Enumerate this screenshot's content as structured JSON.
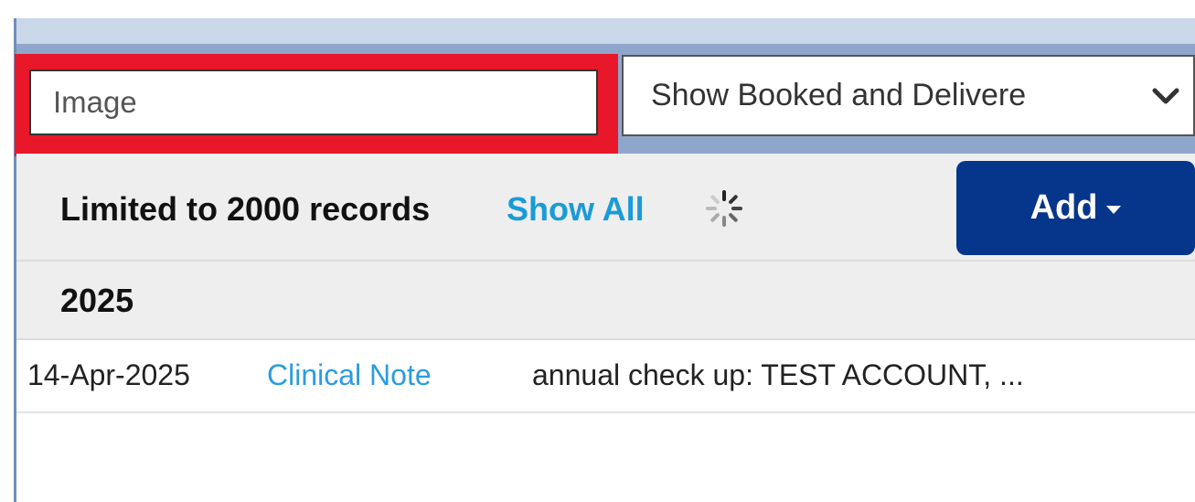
{
  "search": {
    "value": "Image"
  },
  "filter_select": {
    "selected": "Show Booked and Delivere"
  },
  "toolbar": {
    "limit_text": "Limited to 2000 records",
    "show_all_label": "Show All",
    "add_label": "Add"
  },
  "year_group": {
    "year": "2025"
  },
  "records": [
    {
      "date": "14-Apr-2025",
      "type": "Clinical Note",
      "description": "annual check up: TEST ACCOUNT, ..."
    }
  ],
  "colors": {
    "highlight": "#e8182a",
    "add_button": "#06368c",
    "link": "#1a9bd7",
    "filter_bar": "#8fa6cc"
  },
  "icons": [
    "chevron-down-icon",
    "loading-spinner-icon",
    "caret-down-icon"
  ]
}
